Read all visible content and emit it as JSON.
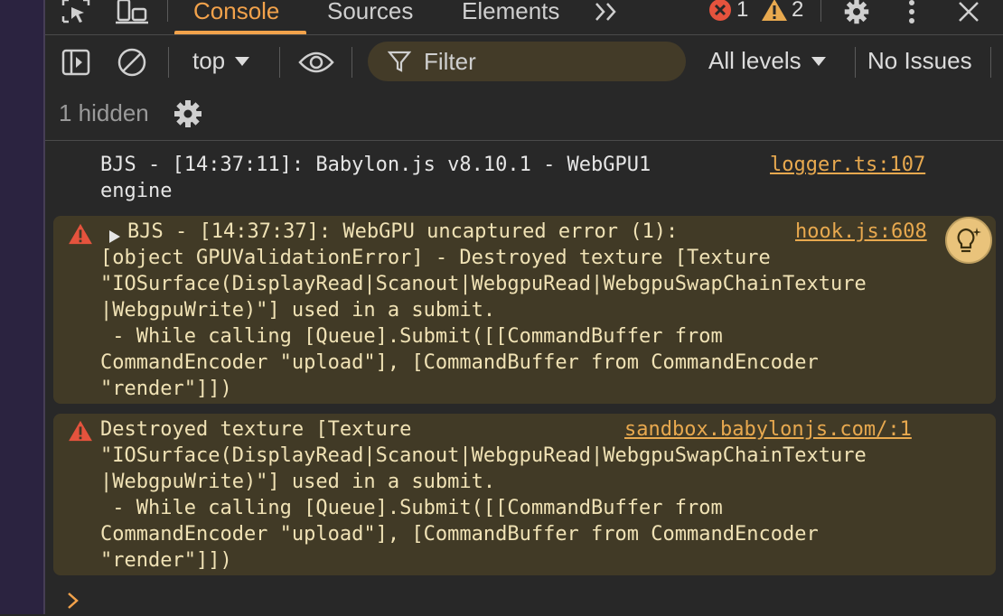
{
  "tabs": [
    {
      "label": "Console",
      "active": true
    },
    {
      "label": "Sources",
      "active": false
    },
    {
      "label": "Elements",
      "active": false
    }
  ],
  "counts": {
    "errors": "1",
    "warnings": "2"
  },
  "icons": {
    "inspect": "inspect-element-icon",
    "device": "device-toolbar-icon",
    "more_tabs": "more-tabs-icon",
    "settings": "gear-icon",
    "menu": "more-vertical-icon",
    "close": "close-icon"
  },
  "toolbar": {
    "context": "top",
    "filter_placeholder": "Filter",
    "levels": "All levels",
    "issues": "No Issues"
  },
  "hidden": "1 hidden",
  "messages": [
    {
      "type": "log",
      "lines": [
        "BJS - [14:37:11]: Babylon.js v8.10.1 - WebGPU1",
        "engine"
      ],
      "source": "logger.ts:107"
    },
    {
      "type": "warning",
      "expandable": true,
      "lines": [
        "BJS - [14:37:37]: WebGPU uncaptured error (1):",
        "[object GPUValidationError] - Destroyed texture [Texture",
        "\"IOSurface(DisplayRead|Scanout|WebgpuRead|WebgpuSwapChainTexture",
        "|WebgpuWrite)\"] used in a submit.",
        " - While calling [Queue].Submit([[CommandBuffer from",
        "CommandEncoder \"upload\"], [CommandBuffer from CommandEncoder",
        "\"render\"]])"
      ],
      "source": "hook.js:608"
    },
    {
      "type": "warning",
      "expandable": false,
      "lines": [
        "Destroyed texture [Texture",
        "\"IOSurface(DisplayRead|Scanout|WebgpuRead|WebgpuSwapChainTexture",
        "|WebgpuWrite)\"] used in a submit.",
        " - While calling [Queue].Submit([[CommandBuffer from",
        "CommandEncoder \"upload\"], [CommandBuffer from CommandEncoder",
        "\"render\"]])"
      ],
      "source": "sandbox.babylonjs.com/:1"
    }
  ],
  "colors": {
    "accent": "#f2a24b",
    "error": "#e5533d",
    "warning": "#e8a94f"
  }
}
